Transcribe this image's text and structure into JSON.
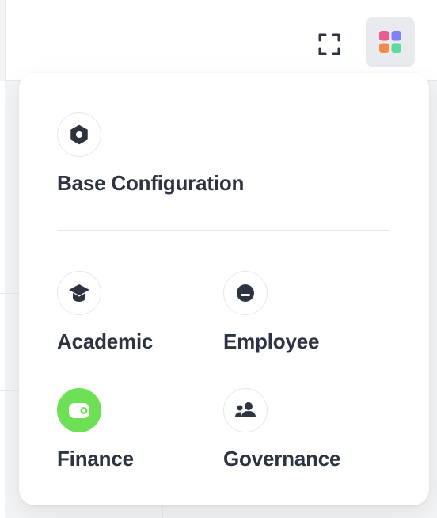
{
  "toolbar": {
    "fullscreen_icon": "fullscreen-icon",
    "apps_icon": "apps-grid-icon",
    "apps_icon_colors": [
      "#ec5b8f",
      "#7f82f0",
      "#f28a4a",
      "#5fd9a0"
    ]
  },
  "menu": {
    "primary": {
      "label": "Base Configuration",
      "icon": "hexagon-nut-icon"
    },
    "modules": [
      {
        "label": "Academic",
        "icon": "graduation-cap-icon",
        "active": false
      },
      {
        "label": "Employee",
        "icon": "employee-icon",
        "active": false
      },
      {
        "label": "Finance",
        "icon": "wallet-icon",
        "active": true
      },
      {
        "label": "Governance",
        "icon": "users-icon",
        "active": false
      }
    ]
  },
  "colors": {
    "accent": "#6ee056",
    "text": "#2d3341",
    "icon": "#2d3341"
  }
}
